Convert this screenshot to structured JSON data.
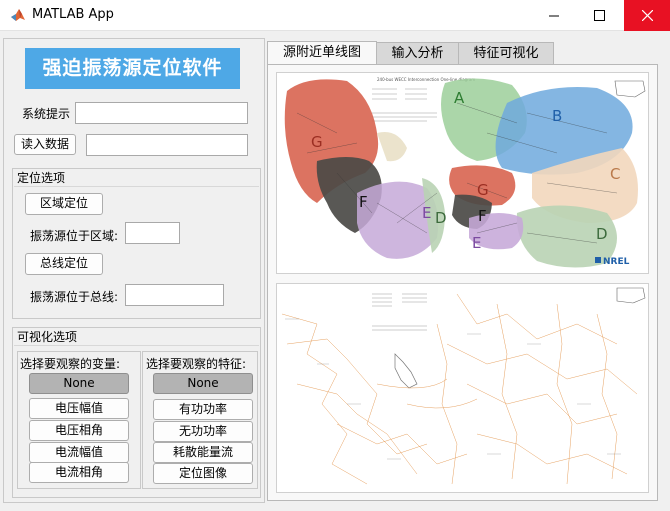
{
  "window": {
    "title": "MATLAB App",
    "minimize_icon": "minimize-icon",
    "maximize_icon": "maximize-icon",
    "close_icon": "close-icon"
  },
  "sidebar": {
    "banner_title": "强迫振荡源定位软件",
    "system_hint_label": "系统提示",
    "system_hint_value": "",
    "read_data_button": "读入数据",
    "data_path_value": ""
  },
  "localize_panel": {
    "title": "定位选项",
    "region_button": "区域定位",
    "region_result_label": "振荡源位于区域:",
    "region_result_value": "",
    "bus_button": "总线定位",
    "bus_result_label": "振荡源位于总线:",
    "bus_result_value": ""
  },
  "visual_panel": {
    "title": "可视化选项",
    "variables_header": "选择要观察的变量:",
    "features_header": "选择要观察的特征:",
    "variables": [
      "None",
      "电压幅值",
      "电压相角",
      "电流幅值",
      "电流相角"
    ],
    "features": [
      "None",
      "有功功率",
      "无功功率",
      "耗散能量流",
      "定位图像"
    ],
    "selected_variable": "None",
    "selected_feature": "None"
  },
  "tabs": [
    "源附近单线图",
    "输入分析",
    "特征可视化"
  ],
  "active_tab": "源附近单线图",
  "map": {
    "title": "240-bus WECC Interconnection One-line diagram",
    "region_labels": [
      "A",
      "B",
      "C",
      "D",
      "E",
      "F",
      "G",
      "G",
      "F",
      "E",
      "D"
    ],
    "logo_text": "NREL",
    "region_colors": {
      "A": "#9ccf9a",
      "B": "#6fa9dd",
      "C": "#f2d7bc",
      "D": "#b9d3b4",
      "E": "#c6a9d8",
      "F": "#4b4a46",
      "G": "#d7604b"
    }
  }
}
